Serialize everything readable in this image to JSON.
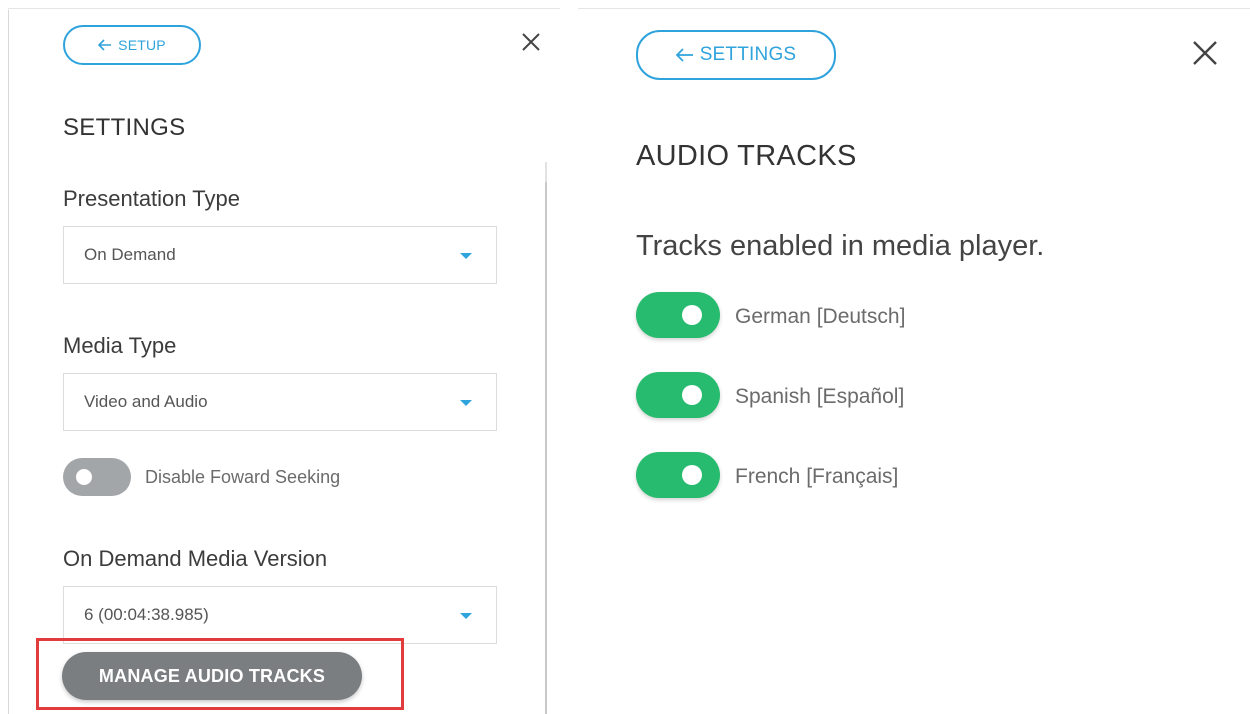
{
  "left": {
    "back_label": "SETUP",
    "title": "SETTINGS",
    "presentation_type": {
      "label": "Presentation Type",
      "value": "On Demand"
    },
    "media_type": {
      "label": "Media Type",
      "value": "Video and Audio"
    },
    "disable_seeking": {
      "label": "Disable Foward Seeking",
      "enabled": false
    },
    "media_version": {
      "label": "On Demand Media Version",
      "value": "6 (00:04:38.985)"
    },
    "manage_button": "MANAGE AUDIO TRACKS"
  },
  "right": {
    "back_label": "SETTINGS",
    "title": "AUDIO TRACKS",
    "intro": "Tracks enabled in media player.",
    "tracks": [
      {
        "label": "German [Deutsch]",
        "enabled": true
      },
      {
        "label": "Spanish [Español]",
        "enabled": true
      },
      {
        "label": "French [Français]",
        "enabled": true
      }
    ]
  },
  "colors": {
    "accent": "#2fa3dc",
    "toggle_on": "#27bb6f",
    "toggle_off": "#a3a6a9",
    "button_gray": "#7b7e80",
    "highlight": "#e23b3b"
  },
  "icons": {
    "back": "arrow-left-icon",
    "close": "close-icon",
    "dropdown": "caret-down-icon"
  }
}
